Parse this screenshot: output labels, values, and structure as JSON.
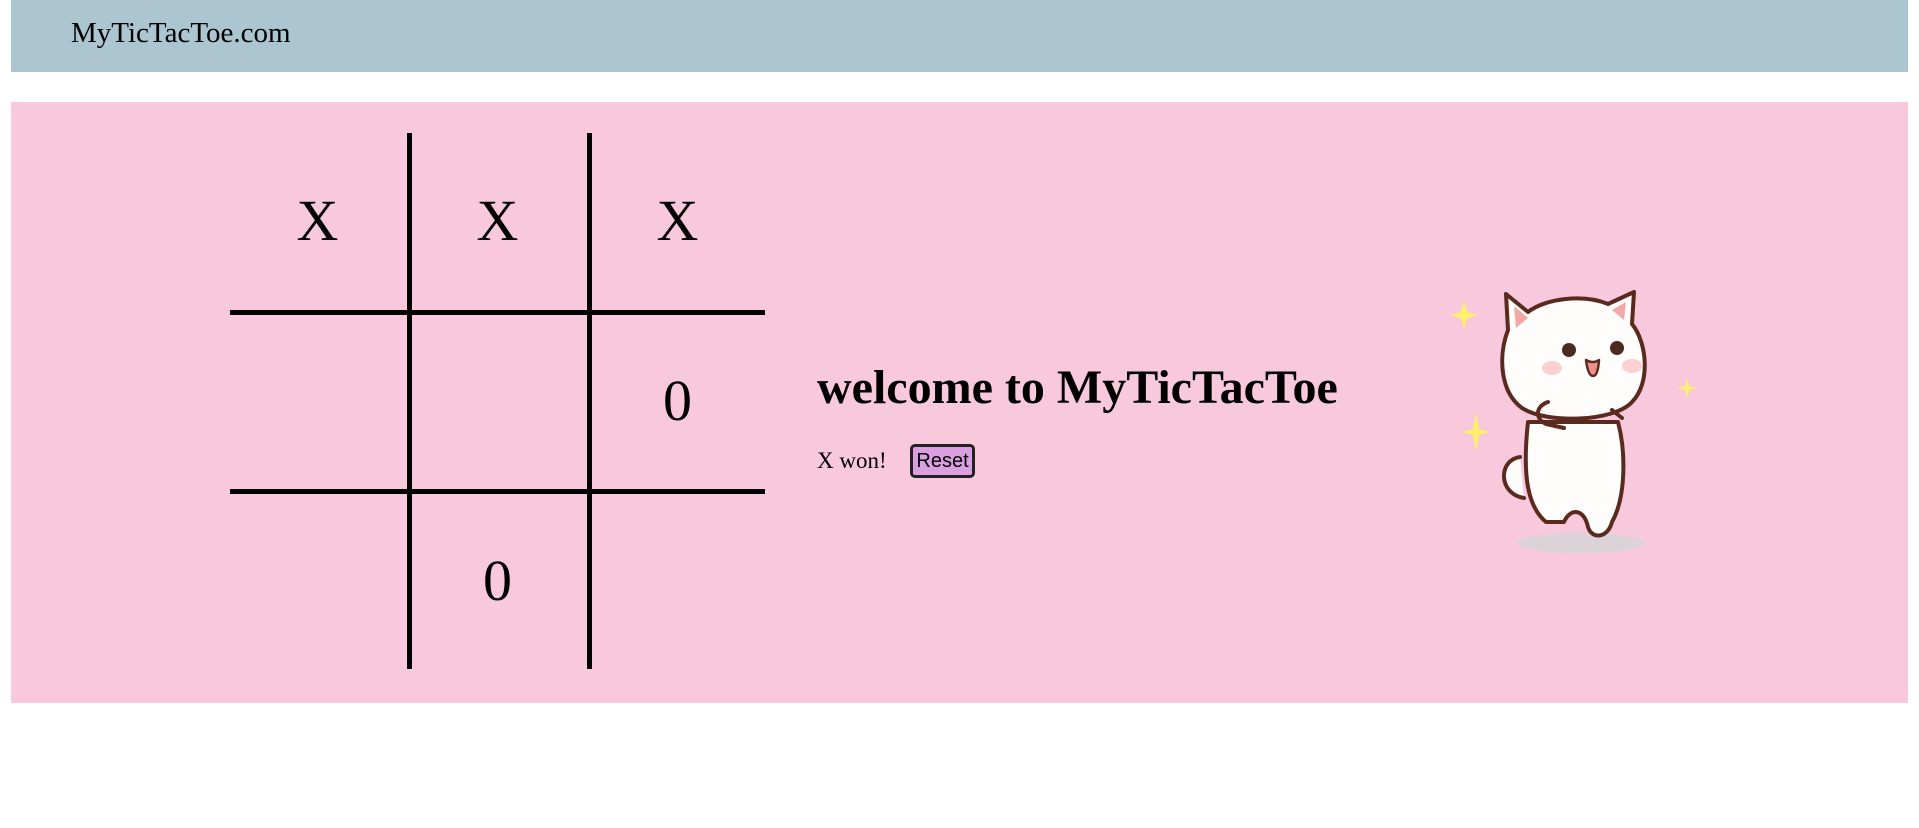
{
  "header": {
    "site_title": "MyTicTacToe.com"
  },
  "board": {
    "cells": [
      "X",
      "X",
      "X",
      "",
      "",
      "0",
      "",
      "0",
      ""
    ]
  },
  "info": {
    "welcome": "welcome to MyTicTacToe",
    "status": "X won!",
    "reset_label": "Reset"
  },
  "colors": {
    "header_bg": "#abc6d0",
    "main_bg": "#f8c8dd",
    "reset_bg": "#da9fe0"
  },
  "icons": {
    "mascot": "cat-mascot-icon"
  }
}
